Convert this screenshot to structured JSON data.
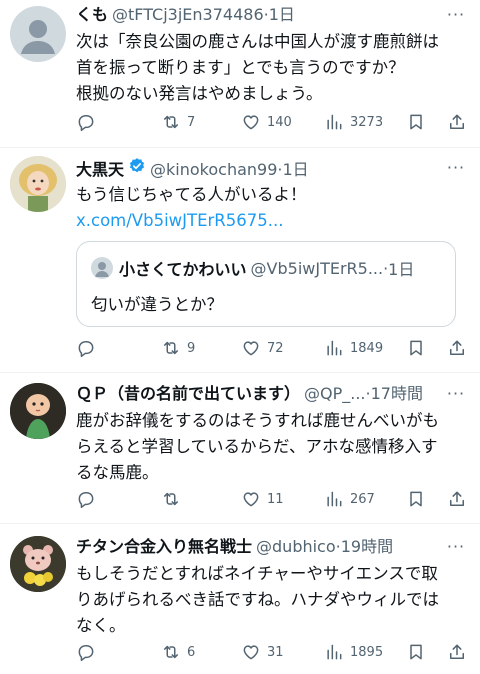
{
  "tweets": [
    {
      "name": "くも",
      "handle": "@tFTCj3jEn374486",
      "time": "1日",
      "text_lines": [
        "次は「奈良公園の鹿さんは中国人が渡す鹿煎餅は",
        "首を振って断ります」とでも言うのですか？",
        "根拠のない発言はやめましょう。"
      ],
      "replies": "",
      "retweets": "7",
      "likes": "140",
      "views": "3273"
    },
    {
      "name": "大黒天",
      "handle": "@kinokochan99",
      "time": "1日",
      "verified": true,
      "text_lines": [
        "もう信じちゃてる人がいるよ！"
      ],
      "link": "x.com/Vb5iwJTErR5675...",
      "quote": {
        "name": "小さくてかわいい",
        "handle": "@Vb5iwJTErR5...",
        "time": "1日",
        "text": "匂いが違うとか？"
      },
      "replies": "",
      "retweets": "9",
      "likes": "72",
      "views": "1849"
    },
    {
      "name": "ＱＰ（昔の名前で出ています）",
      "handle": "@QP_...",
      "time": "17時間",
      "text_lines": [
        "鹿がお辞儀をするのはそうすれば鹿せんべいがも",
        "らえると学習しているからだ、アホな感情移入す",
        "るな馬鹿。"
      ],
      "replies": "",
      "retweets": "",
      "likes": "11",
      "views": "267"
    },
    {
      "name": "チタン合金入り無名戦士",
      "handle": "@dubhico",
      "time": "19時間",
      "text_lines": [
        "もしそうだとすればネイチャーやサイエンスで取",
        "りあげられるべき話ですね。ハナダやウィルでは",
        "なく。"
      ],
      "replies": "",
      "retweets": "6",
      "likes": "31",
      "views": "1895"
    }
  ],
  "separator": "·",
  "more_label": "···",
  "icons": {
    "reply": "reply-icon",
    "retweet": "retweet-icon",
    "like": "heart-icon",
    "views": "views-icon",
    "bookmark": "bookmark-icon",
    "share": "share-icon"
  },
  "colors": {
    "link": "#1d9bf0",
    "secondary_text": "#536471",
    "verified": "#1d9bf0"
  }
}
